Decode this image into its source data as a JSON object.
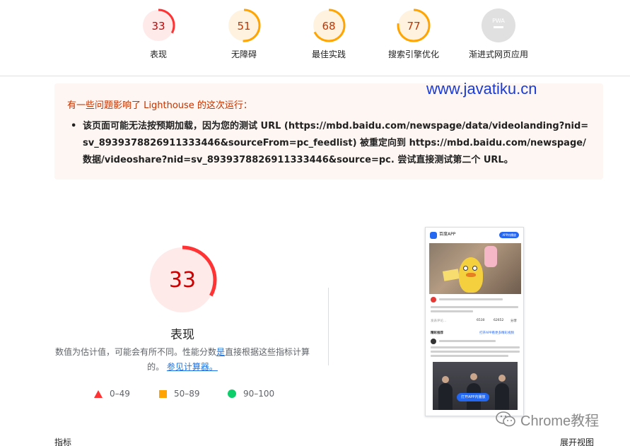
{
  "top_gauges": [
    {
      "score": "33",
      "label": "表现",
      "color": "#ff3333",
      "fill": "#ffeaea",
      "fraction": 0.33
    },
    {
      "score": "51",
      "label": "无障碍",
      "color": "#ffa400",
      "fill": "#fff3e0",
      "fraction": 0.51
    },
    {
      "score": "68",
      "label": "最佳实践",
      "color": "#ffa400",
      "fill": "#fff3e0",
      "fraction": 0.68
    },
    {
      "score": "77",
      "label": "搜索引擎优化",
      "color": "#ffa400",
      "fill": "#fff3e0",
      "fraction": 0.77
    },
    {
      "score": "PWA",
      "label": "渐进式网页应用",
      "color": "#9e9e9e",
      "fill": "#e8e8e8",
      "fraction": 0
    }
  ],
  "warning": {
    "title": "有一些问题影响了 Lighthouse 的这次运行：",
    "items": [
      "该页面可能无法按预期加载，因为您的测试 URL (https://mbd.baidu.com/newspage/data/videolanding?nid=sv_8939378826911333446&sourceFrom=pc_feedlist) 被重定向到 https://mbd.baidu.com/newspage/数据/videoshare?nid=sv_8939378826911333446&source=pc. 尝试直接测试第二个 URL。"
    ]
  },
  "watermark": "www.javatiku.cn",
  "main": {
    "score": "33",
    "fraction": 0.33,
    "color": "#ff3333",
    "fill": "#ffeaea",
    "title": "表现",
    "desc_before": "数值为估计值，可能会有所不同。性能分数",
    "desc_link1": "是",
    "desc_middle": "直接根据这些指标计算的。",
    "desc_link2": "参见计算器。"
  },
  "legend": [
    {
      "shape": "triangle",
      "range": "0–49",
      "color": "#ff3333"
    },
    {
      "shape": "square",
      "range": "50–89",
      "color": "#ffa400"
    },
    {
      "shape": "circle",
      "range": "90–100",
      "color": "#0cce6b"
    }
  ],
  "phone": {
    "app_name": "百度APP",
    "app_btn": "APP内播放",
    "comment_placeholder": "发表评论...",
    "count1": "6530",
    "count2": "62652",
    "share": "分享",
    "section": "精彩推荐",
    "section_link": "打开APP看更多精彩视频",
    "open_app": "打开APP内播放"
  },
  "bottom": {
    "metrics_label": "指标",
    "expand_label": "展开视图"
  },
  "wechat_watermark": "Chrome教程"
}
